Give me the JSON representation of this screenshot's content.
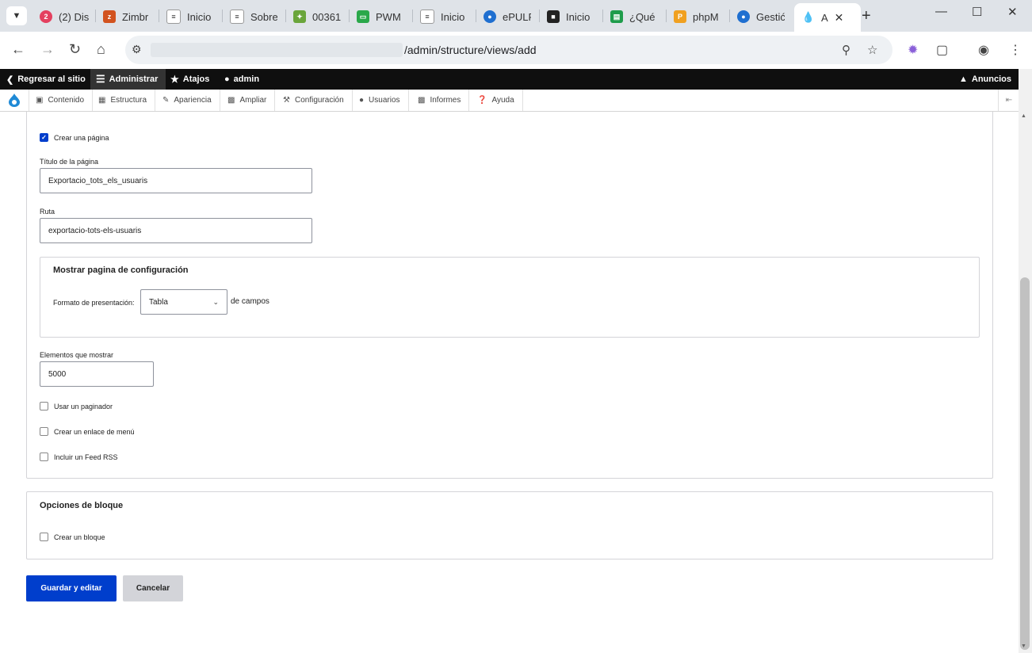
{
  "browser": {
    "tabs": [
      {
        "title": "(2) Dis",
        "icon": "discord-icon",
        "color": "#e4405f"
      },
      {
        "title": "Zimbr",
        "icon": "zimbra-icon",
        "color": "#d2531f"
      },
      {
        "title": "Inicio",
        "icon": "site-icon",
        "color": "#333333"
      },
      {
        "title": "Sobre",
        "icon": "site-icon",
        "color": "#333333"
      },
      {
        "title": "00361",
        "icon": "app-icon",
        "color": "#6aa53b"
      },
      {
        "title": "PWM",
        "icon": "pwm-icon",
        "color": "#2aa84a"
      },
      {
        "title": "Inicio",
        "icon": "site-icon",
        "color": "#333333"
      },
      {
        "title": "ePULF",
        "icon": "drupal-icon",
        "color": "#1f6fd0"
      },
      {
        "title": "Inicio",
        "icon": "site-icon",
        "color": "#222222"
      },
      {
        "title": "¿Qué",
        "icon": "sheets-icon",
        "color": "#1e9c4b"
      },
      {
        "title": "phpM",
        "icon": "pma-icon",
        "color": "#f0a020"
      },
      {
        "title": "Gestić",
        "icon": "drupal-icon",
        "color": "#1f6fd0"
      }
    ],
    "active_tab": {
      "title": "A",
      "icon": "drupal-icon"
    },
    "new_tab": "+",
    "url_path": "/admin/structure/views/add"
  },
  "adminbar": {
    "back": "Regresar al sitio",
    "manage": "Administrar",
    "shortcuts": "Atajos",
    "user": "admin",
    "announcements": "Anuncios"
  },
  "tray": {
    "items": [
      "Contenido",
      "Estructura",
      "Apariencia",
      "Ampliar",
      "Configuración",
      "Usuarios",
      "Informes",
      "Ayuda"
    ]
  },
  "form": {
    "create_page": {
      "label": "Crear una página",
      "checked": true
    },
    "page_title": {
      "label": "Título de la página",
      "value": "Exportacio_tots_els_usuaris"
    },
    "path": {
      "label": "Ruta",
      "value": "exportacio-tots-els-usuaris"
    },
    "display_settings": {
      "title": "Mostrar pagina de configuración",
      "format_label": "Formato de presentación:",
      "format_value": "Tabla",
      "format_suffix": "de campos"
    },
    "items": {
      "label": "Elementos que mostrar",
      "value": "5000"
    },
    "use_pager": {
      "label": "Usar un paginador",
      "checked": false
    },
    "menu_link": {
      "label": "Crear un enlace de menú",
      "checked": false
    },
    "rss_feed": {
      "label": "Incluir un Feed RSS",
      "checked": false
    },
    "block_options": {
      "title": "Opciones de bloque"
    },
    "create_block": {
      "label": "Crear un bloque",
      "checked": false
    },
    "save_button": "Guardar y editar",
    "cancel_button": "Cancelar"
  },
  "colors": {
    "primary": "#003ecc",
    "adminbar": "#0f0f0f"
  }
}
